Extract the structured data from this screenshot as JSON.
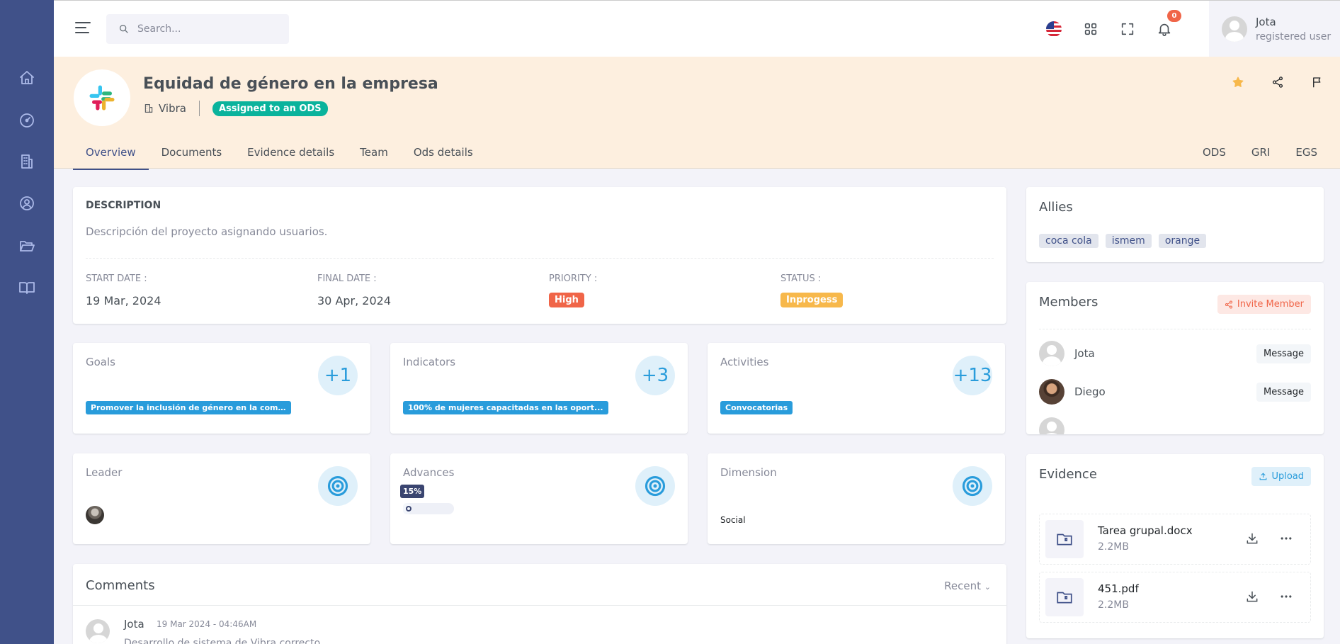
{
  "search": {
    "placeholder": "Search..."
  },
  "header": {
    "notifications_count": "0",
    "user_name": "Jota",
    "user_role": "registered user"
  },
  "project": {
    "title": "Equidad de género en la empresa",
    "company": "Vibra",
    "ods_badge": "Assigned to an ODS",
    "tabs": [
      "Overview",
      "Documents",
      "Evidence details",
      "Team",
      "Ods details"
    ],
    "right_tabs": [
      "ODS",
      "GRI",
      "EGS"
    ]
  },
  "description": {
    "heading": "DESCRIPTION",
    "text": "Descripción del proyecto asignando usuarios.",
    "start_label": "START DATE :",
    "start_value": "19 Mar, 2024",
    "final_label": "FINAL DATE :",
    "final_value": "30 Apr, 2024",
    "priority_label": "PRIORITY :",
    "priority_value": "High",
    "status_label": "STATUS :",
    "status_value": "Inprogess",
    "priority_color": "#f06548",
    "status_color": "#f7b84b"
  },
  "stats": {
    "goals": {
      "title": "Goals",
      "count": "+1",
      "tag": "Promover la inclusión de género en la compañía"
    },
    "indicators": {
      "title": "Indicators",
      "count": "+3",
      "tag": "100% de mujeres capacitadas en las oport..."
    },
    "activities": {
      "title": "Activities",
      "count": "+13",
      "tag": "Convocatorias"
    },
    "leader": {
      "title": "Leader"
    },
    "advances": {
      "title": "Advances",
      "percent": "15%",
      "progress": 0.15
    },
    "dimension": {
      "title": "Dimension",
      "value": "Social"
    }
  },
  "comments": {
    "title": "Comments",
    "sort": "Recent",
    "first": {
      "author": "Jota",
      "date": "19 Mar 2024 - 04:46AM",
      "text": "Desarrollo de sistema de Vibra correcto"
    }
  },
  "allies": {
    "title": "Allies",
    "items": [
      "coca cola",
      "ismem",
      "orange"
    ]
  },
  "members": {
    "title": "Members",
    "invite_label": "Invite Member",
    "items": [
      {
        "name": "Jota",
        "action": "Message"
      },
      {
        "name": "Diego",
        "action": "Message"
      }
    ]
  },
  "evidence": {
    "title": "Evidence",
    "upload_label": "Upload",
    "files": [
      {
        "name": "Tarea grupal.docx",
        "size": "2.2MB"
      },
      {
        "name": "451.pdf",
        "size": "2.2MB"
      }
    ]
  },
  "colors": {
    "sidebar": "#405189",
    "accent": "#299cdb",
    "banner": "#fdefdf",
    "success": "#0ab39c"
  }
}
